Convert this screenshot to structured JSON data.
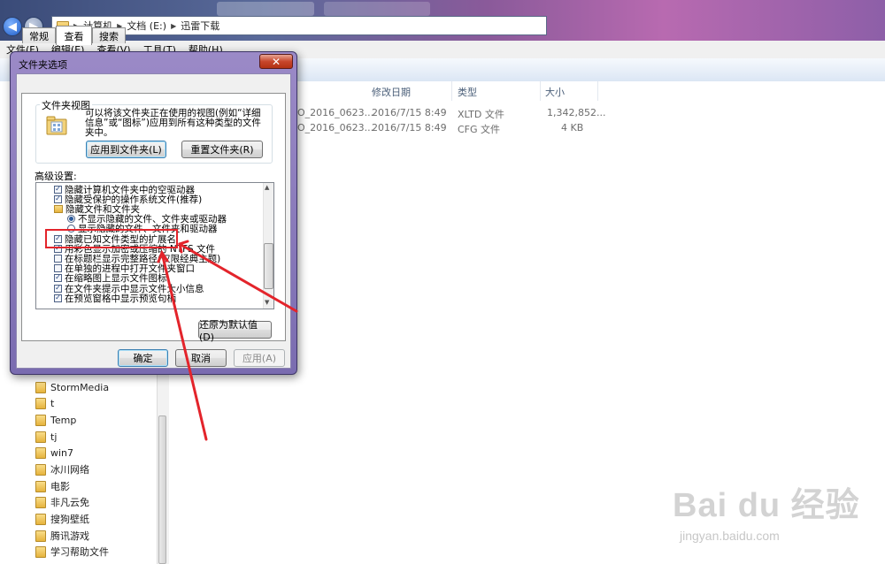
{
  "explorer": {
    "address_crumbs": [
      "计算机",
      "文档 (E:)",
      "迅雷下载"
    ],
    "menu": [
      "文件(F)",
      "编辑(E)",
      "查看(V)",
      "工具(T)",
      "帮助(H)"
    ],
    "columns": [
      "修改日期",
      "类型",
      "大小"
    ],
    "files": [
      {
        "name": "O_2016_0623...",
        "date": "2016/7/15 8:49",
        "type": "XLTD 文件",
        "size": "1,342,852..."
      },
      {
        "name": "O_2016_0623...",
        "date": "2016/7/15 8:49",
        "type": "CFG 文件",
        "size": "4 KB"
      }
    ],
    "nav_items": [
      "StormMedia",
      "t",
      "Temp",
      "tj",
      "win7",
      "冰川网络",
      "电影",
      "非凡云免",
      "搜狗壁纸",
      "腾讯游戏",
      "学习帮助文件"
    ]
  },
  "dialog": {
    "title": "文件夹选项",
    "close_glyph": "✕",
    "tabs": [
      "常规",
      "查看",
      "搜索"
    ],
    "active_tab": "查看",
    "folder_view": {
      "group_label": "文件夹视图",
      "description": "可以将该文件夹正在使用的视图(例如“详细信息”或“图标”)应用到所有这种类型的文件夹中。",
      "apply_button": "应用到文件夹(L)",
      "reset_button": "重置文件夹(R)"
    },
    "advanced_label": "高级设置:",
    "advanced_items": [
      {
        "kind": "checkbox",
        "checked": true,
        "label": "隐藏计算机文件夹中的空驱动器"
      },
      {
        "kind": "checkbox",
        "checked": true,
        "label": "隐藏受保护的操作系统文件(推荐)"
      },
      {
        "kind": "folder",
        "label": "隐藏文件和文件夹"
      },
      {
        "kind": "radio",
        "checked": true,
        "label": "不显示隐藏的文件、文件夹或驱动器"
      },
      {
        "kind": "radio",
        "checked": false,
        "label": "显示隐藏的文件、文件夹和驱动器"
      },
      {
        "kind": "checkbox",
        "checked": true,
        "label": "隐藏已知文件类型的扩展名"
      },
      {
        "kind": "checkbox",
        "checked": true,
        "label": "用彩色显示加密或压缩的 NTFS 文件"
      },
      {
        "kind": "checkbox",
        "checked": false,
        "label": "在标题栏显示完整路径(仅限经典主题)"
      },
      {
        "kind": "checkbox",
        "checked": false,
        "label": "在单独的进程中打开文件夹窗口"
      },
      {
        "kind": "checkbox",
        "checked": true,
        "label": "在缩略图上显示文件图标"
      },
      {
        "kind": "checkbox",
        "checked": true,
        "label": "在文件夹提示中显示文件大小信息"
      },
      {
        "kind": "checkbox",
        "checked": true,
        "label": "在预览窗格中显示预览句柄"
      }
    ],
    "restore_defaults": "还原为默认值(D)",
    "ok": "确定",
    "cancel": "取消",
    "apply": "应用(A)"
  },
  "watermark": {
    "logo": "Bai du 经验",
    "url": "jingyan.baidu.com"
  },
  "colors": {
    "annotation_red": "#e3242b",
    "dialog_frame": "#8d7fc0"
  }
}
